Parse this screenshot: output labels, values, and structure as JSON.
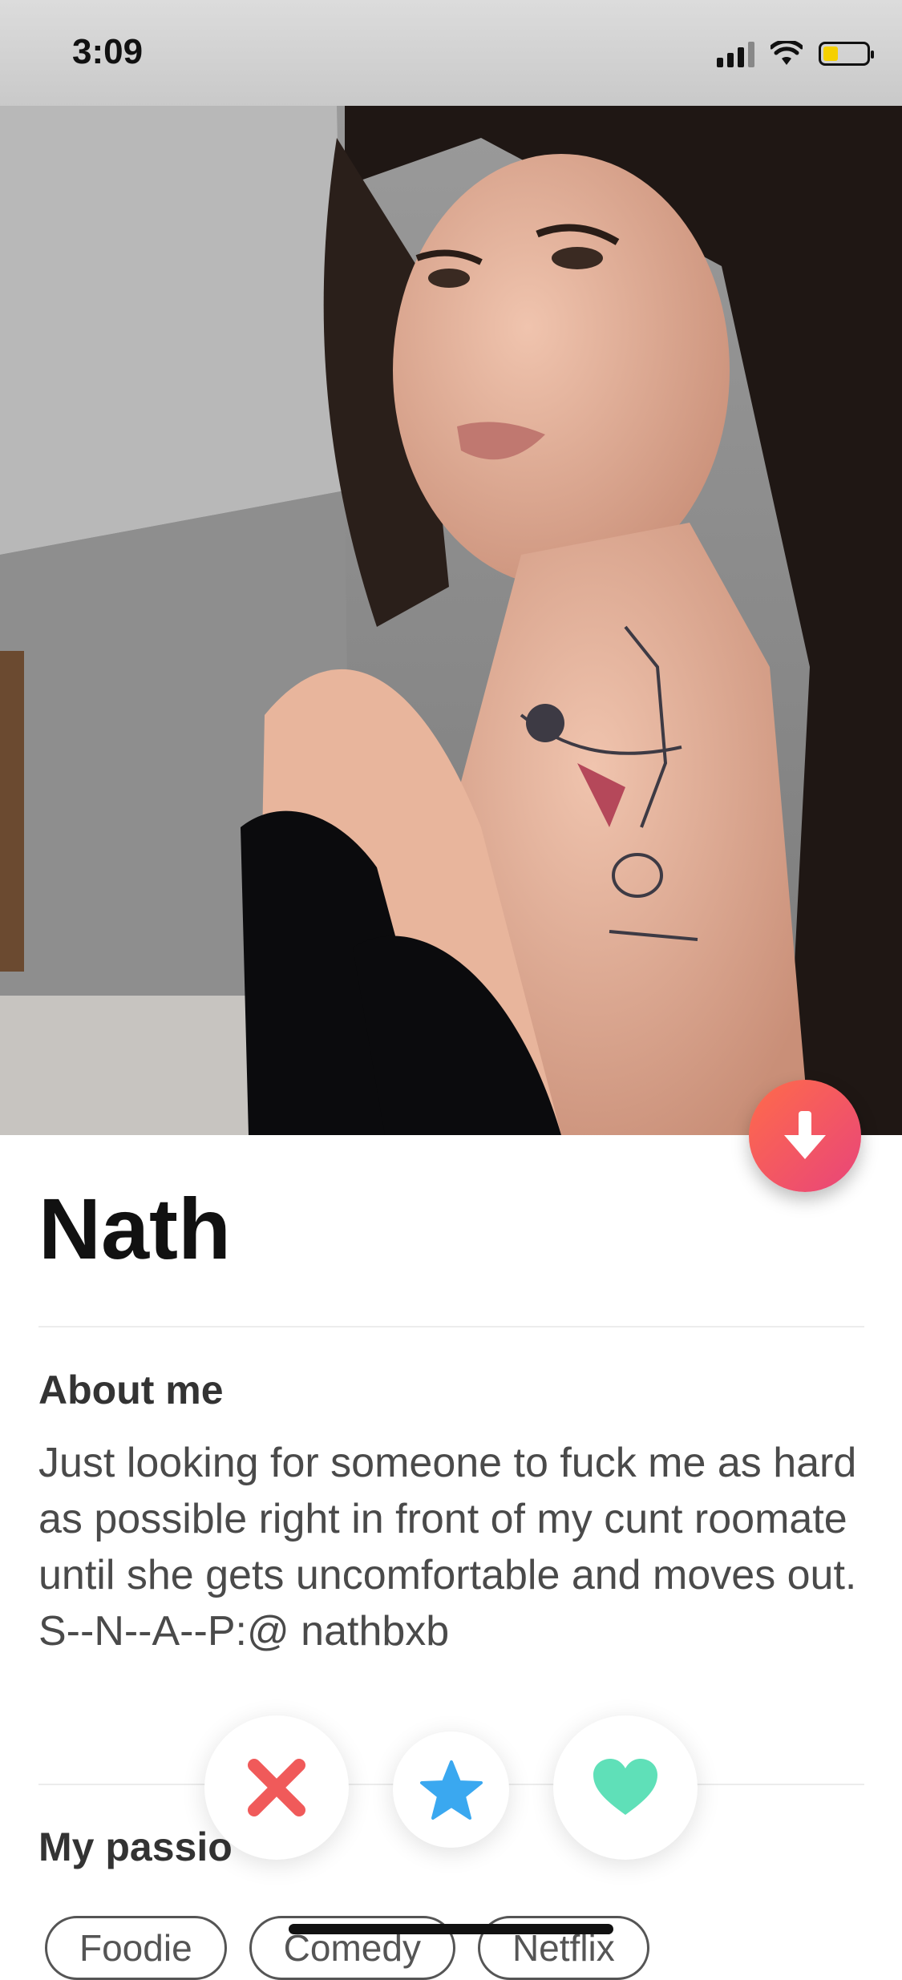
{
  "status": {
    "time": "3:09"
  },
  "profile": {
    "name": "Nath",
    "about_title": "About me",
    "about_text": "Just looking for someone to fuck me as hard as possible right in front of my cunt roomate until she gets uncomfortable and moves out.\nS--N--A--P:@ nathbxb",
    "passions_title": "My passio",
    "passions": [
      "Foodie",
      "Comedy",
      "Netflix"
    ]
  },
  "actions": {
    "expand_icon": "arrow-down-icon",
    "nope_icon": "x-icon",
    "superlike_icon": "star-icon",
    "like_icon": "heart-icon"
  },
  "colors": {
    "accent_gradient_start": "#ff6b4a",
    "accent_gradient_end": "#e8457a",
    "nope": "#f05a5a",
    "superlike": "#3aa8f0",
    "like": "#5fe0b8"
  }
}
